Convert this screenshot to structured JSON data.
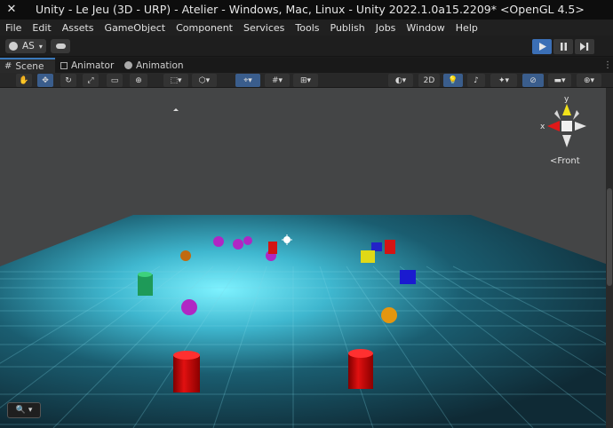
{
  "window": {
    "title": "Unity - Le Jeu (3D - URP) - Atelier - Windows, Mac, Linux - Unity 2022.1.0a15.2209* <OpenGL 4.5>"
  },
  "menu": [
    "File",
    "Edit",
    "Assets",
    "GameObject",
    "Component",
    "Services",
    "Tools",
    "Publish",
    "Jobs",
    "Window",
    "Help"
  ],
  "toolbar": {
    "account_label": "AS"
  },
  "tabs": [
    {
      "label": "Scene",
      "icon": "hash-icon"
    },
    {
      "label": "Animator",
      "icon": "animator-icon"
    },
    {
      "label": "Animation",
      "icon": "clock-icon"
    }
  ],
  "scene_toolbar": {
    "mode_2d_label": "2D"
  },
  "gizmo": {
    "front_label": "Front",
    "x_label": "x",
    "y_label": "y"
  },
  "colors": {
    "play_active": "#3b6fb6",
    "tab_accent": "#3a79bb",
    "floor_glow": "#5fe6ff"
  }
}
